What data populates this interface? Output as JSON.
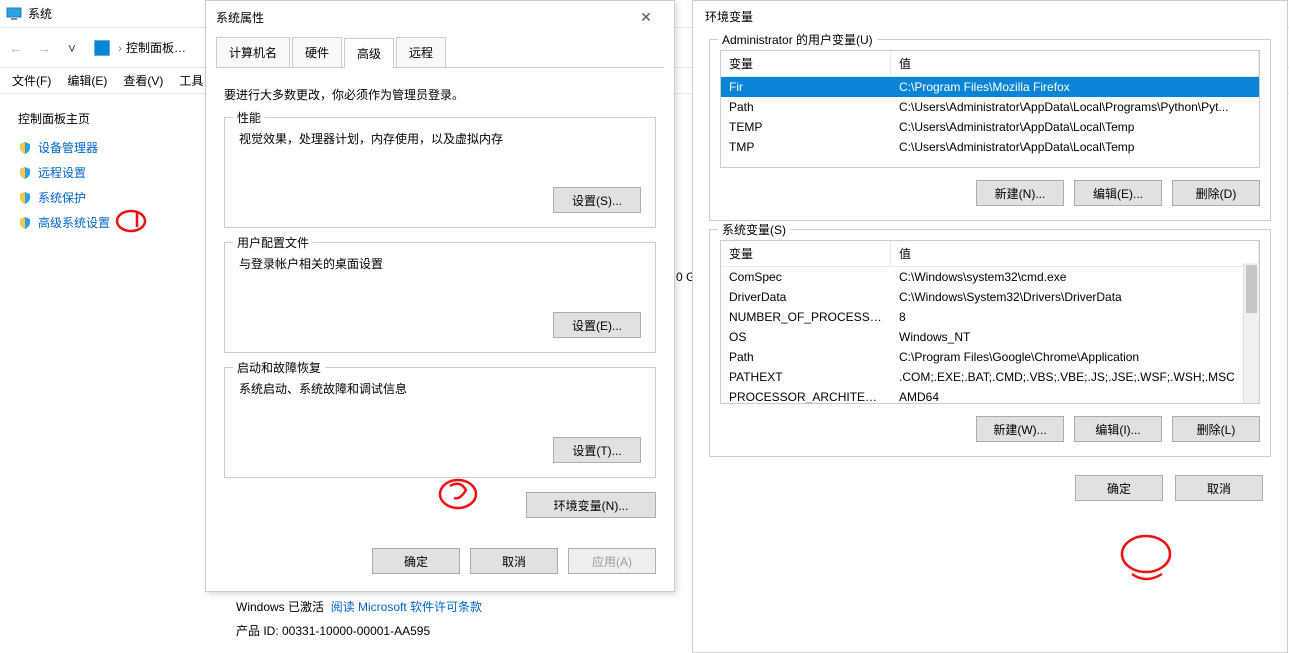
{
  "bg": {
    "title": "系统",
    "addr": {
      "start": "控制面板…"
    },
    "menus": [
      "文件(F)",
      "编辑(E)",
      "查看(V)",
      "工具"
    ],
    "sidebarHeader": "控制面板主页",
    "sidebarLinks": [
      "设备管理器",
      "远程设置",
      "系统保护",
      "高级系统设置"
    ]
  },
  "sysprop": {
    "title": "系统属性",
    "tabs": [
      "计算机名",
      "硬件",
      "高级",
      "远程"
    ],
    "activeTab": 2,
    "notice": "要进行大多数更改，你必须作为管理员登录。",
    "perf": {
      "title": "性能",
      "desc": "视觉效果，处理器计划，内存使用，以及虚拟内存",
      "btn": "设置(S)..."
    },
    "profiles": {
      "title": "用户配置文件",
      "desc": "与登录帐户相关的桌面设置",
      "btn": "设置(E)..."
    },
    "startup": {
      "title": "启动和故障恢复",
      "desc": "系统启动、系统故障和调试信息",
      "btn": "设置(T)..."
    },
    "envBtn": "环境变量(N)...",
    "ok": "确定",
    "cancel": "取消",
    "apply": "应用(A)"
  },
  "env": {
    "title": "环境变量",
    "userGroup": "Administrator 的用户变量(U)",
    "sysGroup": "系统变量(S)",
    "colVar": "变量",
    "colVal": "值",
    "userVars": [
      {
        "n": "Fir",
        "v": "C:\\Program Files\\Mozilla Firefox",
        "sel": true
      },
      {
        "n": "Path",
        "v": "C:\\Users\\Administrator\\AppData\\Local\\Programs\\Python\\Pyt..."
      },
      {
        "n": "TEMP",
        "v": "C:\\Users\\Administrator\\AppData\\Local\\Temp"
      },
      {
        "n": "TMP",
        "v": "C:\\Users\\Administrator\\AppData\\Local\\Temp"
      }
    ],
    "sysVars": [
      {
        "n": "ComSpec",
        "v": "C:\\Windows\\system32\\cmd.exe"
      },
      {
        "n": "DriverData",
        "v": "C:\\Windows\\System32\\Drivers\\DriverData"
      },
      {
        "n": "NUMBER_OF_PROCESSORS",
        "v": "8"
      },
      {
        "n": "OS",
        "v": "Windows_NT"
      },
      {
        "n": "Path",
        "v": "C:\\Program Files\\Google\\Chrome\\Application"
      },
      {
        "n": "PATHEXT",
        "v": ".COM;.EXE;.BAT;.CMD;.VBS;.VBE;.JS;.JSE;.WSF;.WSH;.MSC"
      },
      {
        "n": "PROCESSOR_ARCHITECT...",
        "v": "AMD64"
      }
    ],
    "newBtnU": "新建(N)...",
    "editBtnU": "编辑(E)...",
    "delBtnU": "删除(D)",
    "newBtnS": "新建(W)...",
    "editBtnS": "编辑(I)...",
    "delBtnS": "删除(L)",
    "ok": "确定",
    "cancel": "取消"
  },
  "activation": {
    "label": "Windows 已激活",
    "link": "阅读 Microsoft 软件许可条款",
    "prodId": "产品 ID: 00331-10000-00001-AA595"
  },
  "disk": "0 G"
}
